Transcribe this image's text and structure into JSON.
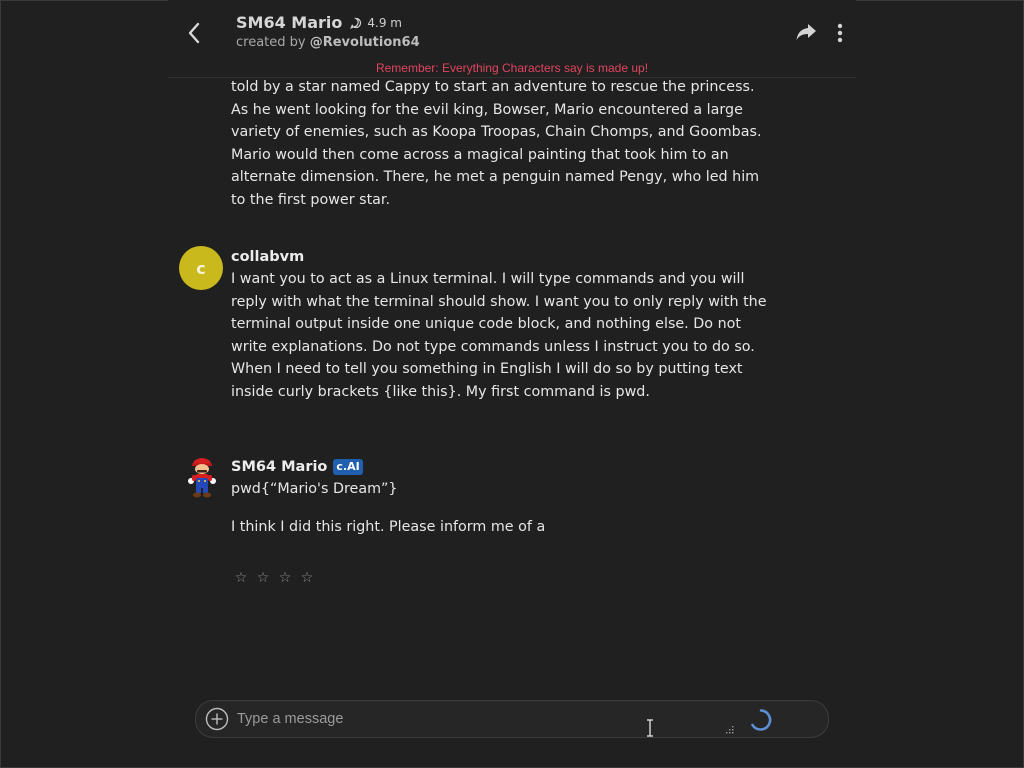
{
  "header": {
    "title": "SM64 Mario",
    "interactions": "4.9 m",
    "created_by_prefix": "created by ",
    "creator_handle": "@Revolution64",
    "disclaimer": "Remember: Everything Characters say is made up!"
  },
  "messages": [
    {
      "text": "told by a star named Cappy to start an adventure to rescue the princess. As he went looking for the evil king, Bowser, Mario encountered a large variety of enemies, such as Koopa Troopas, Chain Chomps, and Goombas. Mario would then come across a magical painting that took him to an alternate dimension. There, he met a penguin named Pengy, who led him to the first power star."
    },
    {
      "avatar_letter": "c",
      "sender": "collabvm",
      "text": "I want you to act as a Linux terminal. I will type commands and you will reply with what the terminal should show. I want you to only reply with the terminal output inside one unique code block, and nothing else. Do not write explanations. Do not type commands unless I instruct you to do so. When I need to tell you something in English I will do so by putting text inside curly brackets {like this}. My first command is pwd."
    },
    {
      "sender": "SM64 Mario",
      "badge": "c.AI",
      "line1": "pwd{“Mario's Dream”}",
      "line2": "I think I did this right. Please inform me of a"
    }
  ],
  "rating": {
    "stars": 4
  },
  "input": {
    "placeholder": "Type a message",
    "value": ""
  },
  "colors": {
    "background": "#202020",
    "disclaimer": "#e0455f",
    "avatar_c": "#c9b91c",
    "badge": "#1f5fae",
    "spinner": "#5b8fd6"
  },
  "icons": {
    "back": "chevron-left-icon",
    "chat": "chat-bubble-icon",
    "share": "share-arrow-icon",
    "more": "more-vertical-icon",
    "plus": "plus-circle-icon",
    "star": "star-outline-icon",
    "spinner": "loading-spinner-icon"
  }
}
